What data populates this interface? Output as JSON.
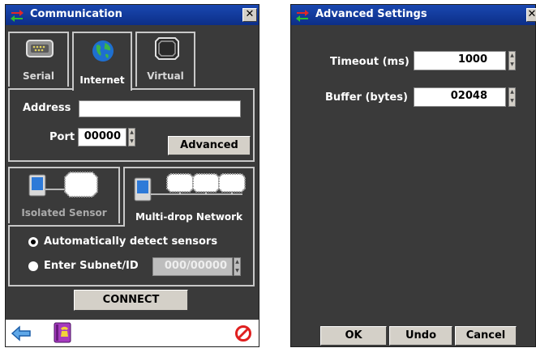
{
  "communication": {
    "title": "Communication",
    "close_glyph": "✕",
    "tabs": [
      {
        "label": "Serial",
        "icon": "serial-port-icon",
        "selected": false
      },
      {
        "label": "Internet",
        "icon": "globe-icon",
        "selected": true
      },
      {
        "label": "Virtual",
        "icon": "virtual-port-icon",
        "selected": false
      }
    ],
    "address_label": "Address",
    "address_value": "",
    "port_label": "Port",
    "port_value": "00000",
    "advanced_label": "Advanced",
    "modes": [
      {
        "label": "Isolated Sensor",
        "selected": false
      },
      {
        "label": "Multi-drop Network",
        "selected": true
      }
    ],
    "auto_detect_label": "Automatically detect sensors",
    "auto_detect_selected": true,
    "subnet_label": "Enter Subnet/ID",
    "subnet_value": "000/00000",
    "connect_label": "CONNECT",
    "bottom_icons": [
      "back-arrow-icon",
      "phone-book-icon",
      "stop-icon"
    ]
  },
  "advanced": {
    "title": "Advanced Settings",
    "timeout_label": "Timeout (ms)",
    "timeout_value": "1000",
    "buffer_label": "Buffer (bytes)",
    "buffer_value": "02048",
    "ok_label": "OK",
    "undo_label": "Undo",
    "cancel_label": "Cancel"
  },
  "colors": {
    "titlebar": "#0c2f88",
    "window_bg": "#3a3a3a",
    "button_face": "#d4d0c8"
  }
}
